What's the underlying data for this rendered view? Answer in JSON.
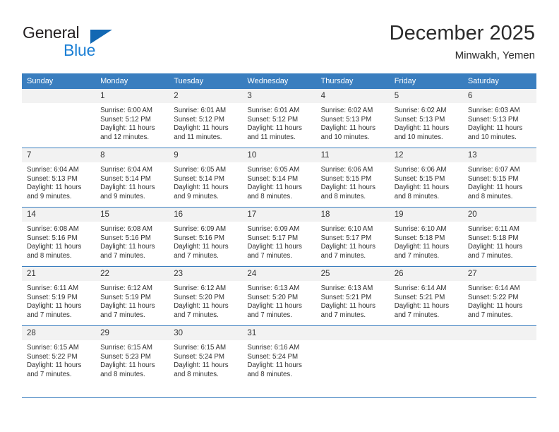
{
  "logo": {
    "primary_text": "General",
    "secondary_text": "Blue",
    "triangle_icon": "blue-triangle-icon",
    "primary_color": "#231f20",
    "secondary_color": "#1b7fd4",
    "triangle_color": "#1268b3"
  },
  "header": {
    "title": "December 2025",
    "subtitle": "Minwakh, Yemen"
  },
  "theme": {
    "header_bg": "#3a7ebf",
    "header_text": "#ffffff",
    "daynum_bg": "#f2f2f2",
    "grid_line": "#3a7ebf",
    "body_text": "#2f2f2f"
  },
  "weekdays": [
    "Sunday",
    "Monday",
    "Tuesday",
    "Wednesday",
    "Thursday",
    "Friday",
    "Saturday"
  ],
  "weeks": [
    [
      {
        "day": "",
        "sunrise": "",
        "sunset": "",
        "daylight_line1": "",
        "daylight_line2": ""
      },
      {
        "day": "1",
        "sunrise": "Sunrise: 6:00 AM",
        "sunset": "Sunset: 5:12 PM",
        "daylight_line1": "Daylight: 11 hours",
        "daylight_line2": "and 12 minutes."
      },
      {
        "day": "2",
        "sunrise": "Sunrise: 6:01 AM",
        "sunset": "Sunset: 5:12 PM",
        "daylight_line1": "Daylight: 11 hours",
        "daylight_line2": "and 11 minutes."
      },
      {
        "day": "3",
        "sunrise": "Sunrise: 6:01 AM",
        "sunset": "Sunset: 5:12 PM",
        "daylight_line1": "Daylight: 11 hours",
        "daylight_line2": "and 11 minutes."
      },
      {
        "day": "4",
        "sunrise": "Sunrise: 6:02 AM",
        "sunset": "Sunset: 5:13 PM",
        "daylight_line1": "Daylight: 11 hours",
        "daylight_line2": "and 10 minutes."
      },
      {
        "day": "5",
        "sunrise": "Sunrise: 6:02 AM",
        "sunset": "Sunset: 5:13 PM",
        "daylight_line1": "Daylight: 11 hours",
        "daylight_line2": "and 10 minutes."
      },
      {
        "day": "6",
        "sunrise": "Sunrise: 6:03 AM",
        "sunset": "Sunset: 5:13 PM",
        "daylight_line1": "Daylight: 11 hours",
        "daylight_line2": "and 10 minutes."
      }
    ],
    [
      {
        "day": "7",
        "sunrise": "Sunrise: 6:04 AM",
        "sunset": "Sunset: 5:13 PM",
        "daylight_line1": "Daylight: 11 hours",
        "daylight_line2": "and 9 minutes."
      },
      {
        "day": "8",
        "sunrise": "Sunrise: 6:04 AM",
        "sunset": "Sunset: 5:14 PM",
        "daylight_line1": "Daylight: 11 hours",
        "daylight_line2": "and 9 minutes."
      },
      {
        "day": "9",
        "sunrise": "Sunrise: 6:05 AM",
        "sunset": "Sunset: 5:14 PM",
        "daylight_line1": "Daylight: 11 hours",
        "daylight_line2": "and 9 minutes."
      },
      {
        "day": "10",
        "sunrise": "Sunrise: 6:05 AM",
        "sunset": "Sunset: 5:14 PM",
        "daylight_line1": "Daylight: 11 hours",
        "daylight_line2": "and 8 minutes."
      },
      {
        "day": "11",
        "sunrise": "Sunrise: 6:06 AM",
        "sunset": "Sunset: 5:15 PM",
        "daylight_line1": "Daylight: 11 hours",
        "daylight_line2": "and 8 minutes."
      },
      {
        "day": "12",
        "sunrise": "Sunrise: 6:06 AM",
        "sunset": "Sunset: 5:15 PM",
        "daylight_line1": "Daylight: 11 hours",
        "daylight_line2": "and 8 minutes."
      },
      {
        "day": "13",
        "sunrise": "Sunrise: 6:07 AM",
        "sunset": "Sunset: 5:15 PM",
        "daylight_line1": "Daylight: 11 hours",
        "daylight_line2": "and 8 minutes."
      }
    ],
    [
      {
        "day": "14",
        "sunrise": "Sunrise: 6:08 AM",
        "sunset": "Sunset: 5:16 PM",
        "daylight_line1": "Daylight: 11 hours",
        "daylight_line2": "and 8 minutes."
      },
      {
        "day": "15",
        "sunrise": "Sunrise: 6:08 AM",
        "sunset": "Sunset: 5:16 PM",
        "daylight_line1": "Daylight: 11 hours",
        "daylight_line2": "and 7 minutes."
      },
      {
        "day": "16",
        "sunrise": "Sunrise: 6:09 AM",
        "sunset": "Sunset: 5:16 PM",
        "daylight_line1": "Daylight: 11 hours",
        "daylight_line2": "and 7 minutes."
      },
      {
        "day": "17",
        "sunrise": "Sunrise: 6:09 AM",
        "sunset": "Sunset: 5:17 PM",
        "daylight_line1": "Daylight: 11 hours",
        "daylight_line2": "and 7 minutes."
      },
      {
        "day": "18",
        "sunrise": "Sunrise: 6:10 AM",
        "sunset": "Sunset: 5:17 PM",
        "daylight_line1": "Daylight: 11 hours",
        "daylight_line2": "and 7 minutes."
      },
      {
        "day": "19",
        "sunrise": "Sunrise: 6:10 AM",
        "sunset": "Sunset: 5:18 PM",
        "daylight_line1": "Daylight: 11 hours",
        "daylight_line2": "and 7 minutes."
      },
      {
        "day": "20",
        "sunrise": "Sunrise: 6:11 AM",
        "sunset": "Sunset: 5:18 PM",
        "daylight_line1": "Daylight: 11 hours",
        "daylight_line2": "and 7 minutes."
      }
    ],
    [
      {
        "day": "21",
        "sunrise": "Sunrise: 6:11 AM",
        "sunset": "Sunset: 5:19 PM",
        "daylight_line1": "Daylight: 11 hours",
        "daylight_line2": "and 7 minutes."
      },
      {
        "day": "22",
        "sunrise": "Sunrise: 6:12 AM",
        "sunset": "Sunset: 5:19 PM",
        "daylight_line1": "Daylight: 11 hours",
        "daylight_line2": "and 7 minutes."
      },
      {
        "day": "23",
        "sunrise": "Sunrise: 6:12 AM",
        "sunset": "Sunset: 5:20 PM",
        "daylight_line1": "Daylight: 11 hours",
        "daylight_line2": "and 7 minutes."
      },
      {
        "day": "24",
        "sunrise": "Sunrise: 6:13 AM",
        "sunset": "Sunset: 5:20 PM",
        "daylight_line1": "Daylight: 11 hours",
        "daylight_line2": "and 7 minutes."
      },
      {
        "day": "25",
        "sunrise": "Sunrise: 6:13 AM",
        "sunset": "Sunset: 5:21 PM",
        "daylight_line1": "Daylight: 11 hours",
        "daylight_line2": "and 7 minutes."
      },
      {
        "day": "26",
        "sunrise": "Sunrise: 6:14 AM",
        "sunset": "Sunset: 5:21 PM",
        "daylight_line1": "Daylight: 11 hours",
        "daylight_line2": "and 7 minutes."
      },
      {
        "day": "27",
        "sunrise": "Sunrise: 6:14 AM",
        "sunset": "Sunset: 5:22 PM",
        "daylight_line1": "Daylight: 11 hours",
        "daylight_line2": "and 7 minutes."
      }
    ],
    [
      {
        "day": "28",
        "sunrise": "Sunrise: 6:15 AM",
        "sunset": "Sunset: 5:22 PM",
        "daylight_line1": "Daylight: 11 hours",
        "daylight_line2": "and 7 minutes."
      },
      {
        "day": "29",
        "sunrise": "Sunrise: 6:15 AM",
        "sunset": "Sunset: 5:23 PM",
        "daylight_line1": "Daylight: 11 hours",
        "daylight_line2": "and 8 minutes."
      },
      {
        "day": "30",
        "sunrise": "Sunrise: 6:15 AM",
        "sunset": "Sunset: 5:24 PM",
        "daylight_line1": "Daylight: 11 hours",
        "daylight_line2": "and 8 minutes."
      },
      {
        "day": "31",
        "sunrise": "Sunrise: 6:16 AM",
        "sunset": "Sunset: 5:24 PM",
        "daylight_line1": "Daylight: 11 hours",
        "daylight_line2": "and 8 minutes."
      },
      {
        "day": "",
        "sunrise": "",
        "sunset": "",
        "daylight_line1": "",
        "daylight_line2": ""
      },
      {
        "day": "",
        "sunrise": "",
        "sunset": "",
        "daylight_line1": "",
        "daylight_line2": ""
      },
      {
        "day": "",
        "sunrise": "",
        "sunset": "",
        "daylight_line1": "",
        "daylight_line2": ""
      }
    ]
  ]
}
